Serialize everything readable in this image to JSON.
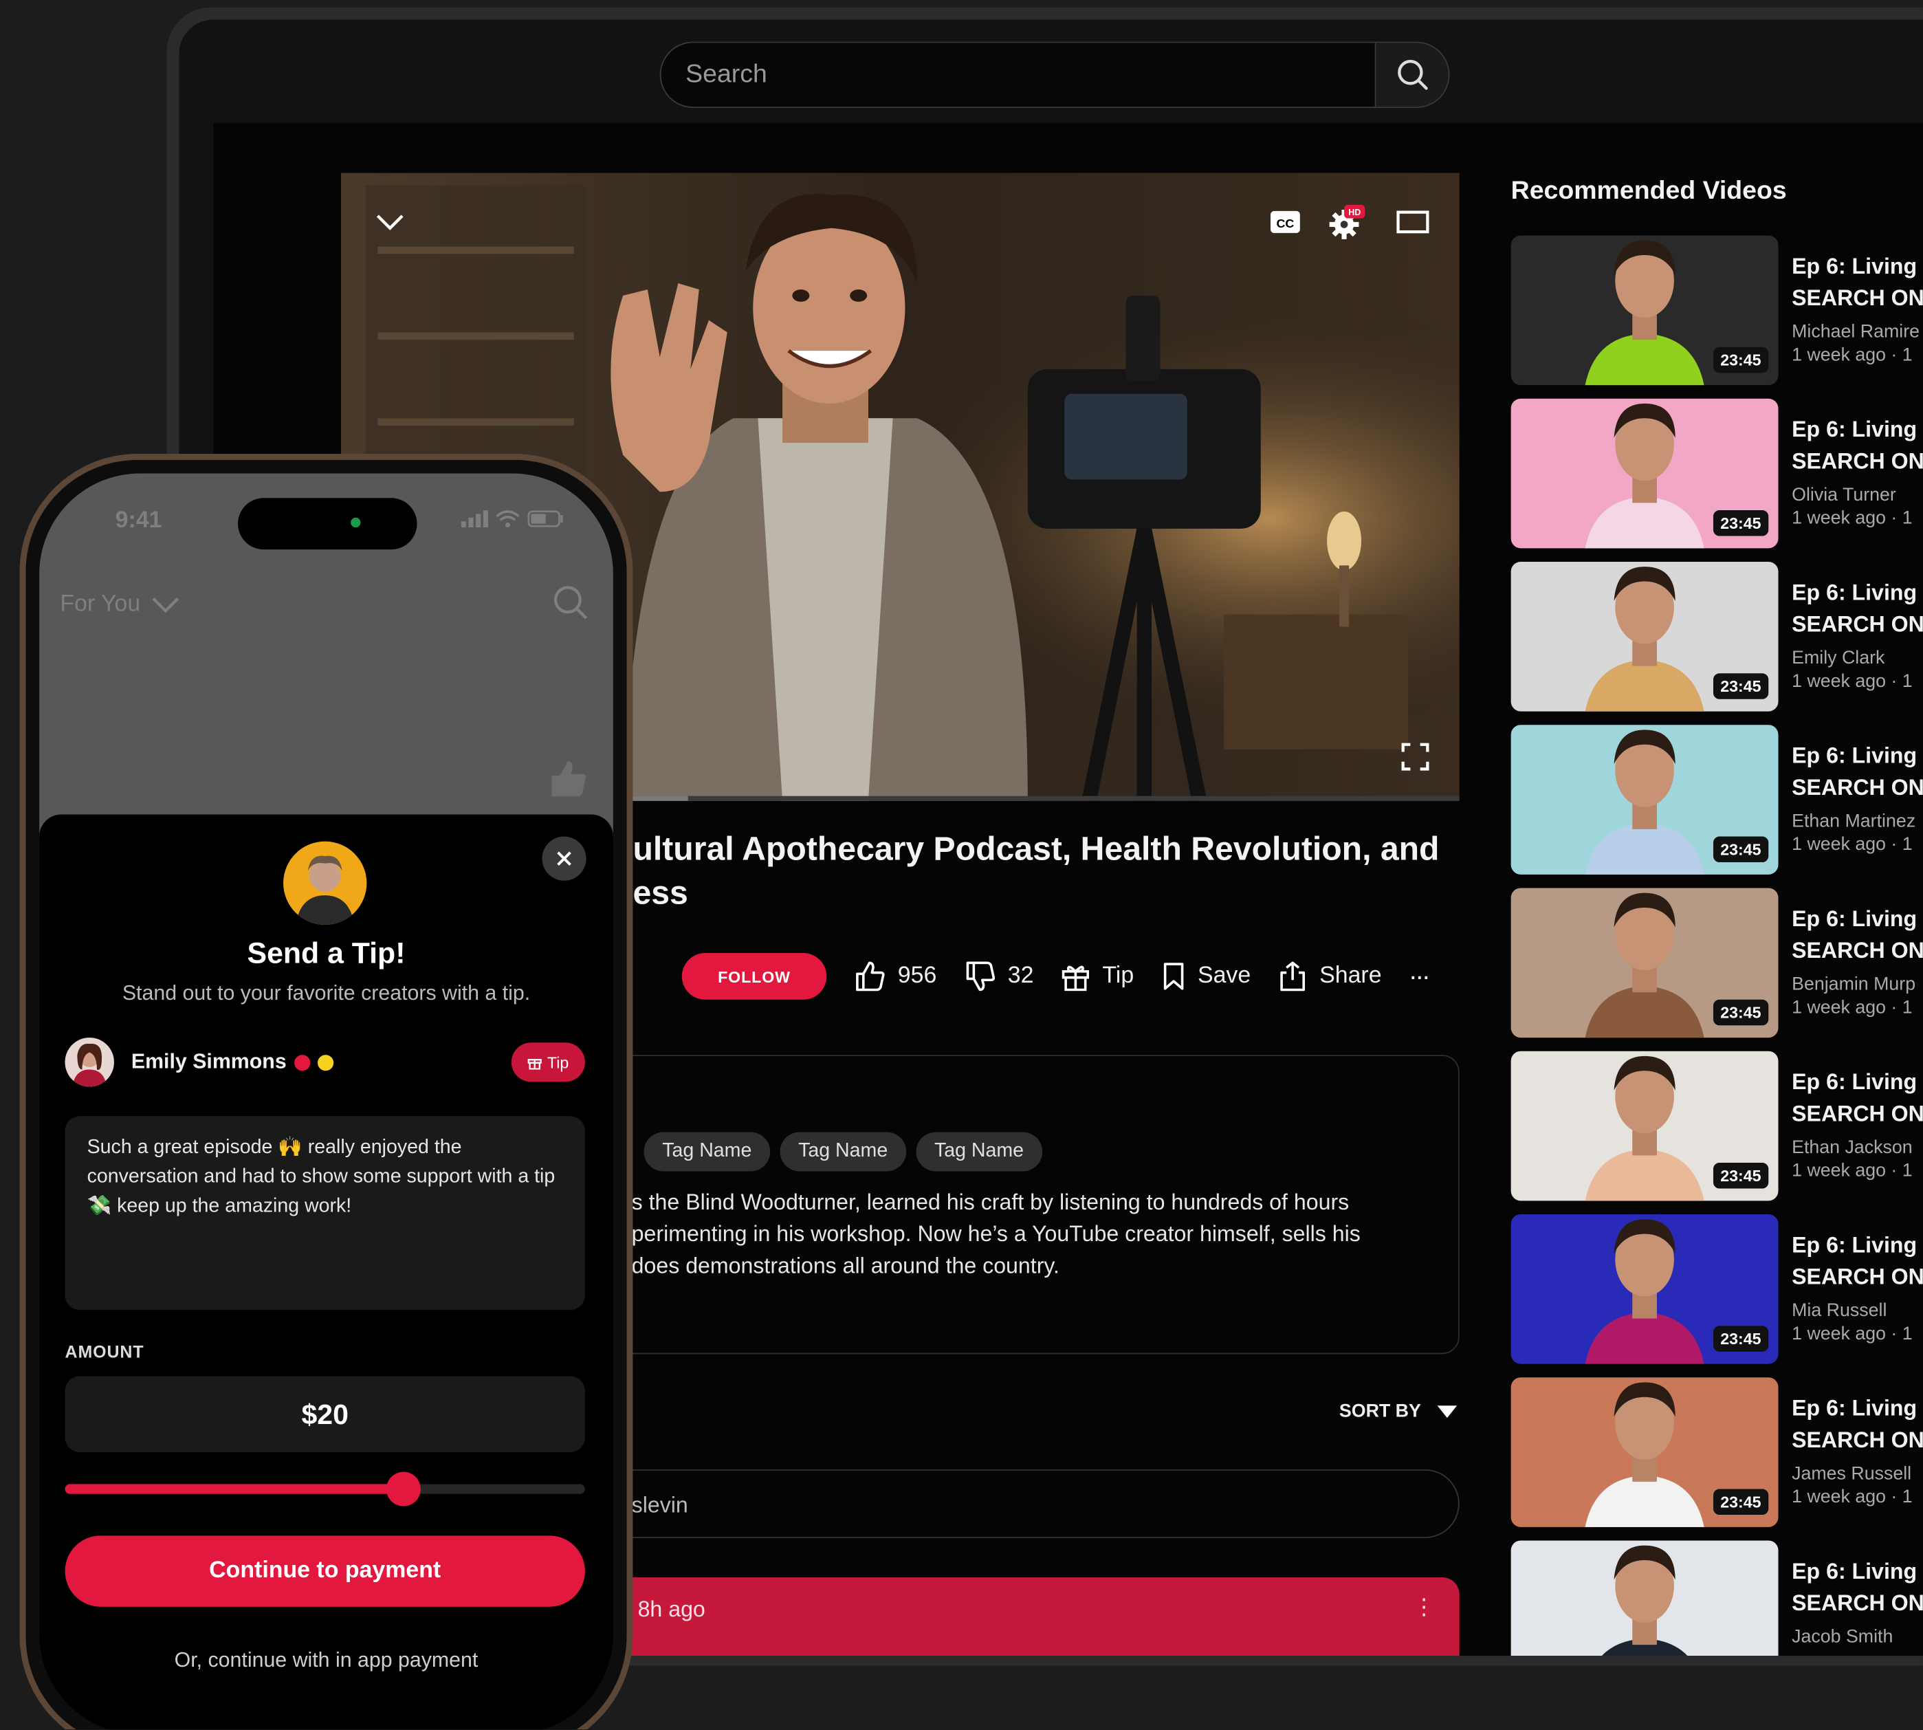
{
  "search": {
    "placeholder": "Search"
  },
  "player": {
    "cc_icon": "closed-captions-icon",
    "hd_badge": "HD",
    "progress_fraction": 0.31
  },
  "video": {
    "title_line1": "ultural Apothecary Podcast, Health Revolution, and",
    "title_line2": "ess",
    "follow_label": "FOLLOW",
    "likes": "956",
    "dislikes": "32",
    "tip_label": "Tip",
    "save_label": "Save",
    "share_label": "Share",
    "more_label": "···"
  },
  "description": {
    "tags": [
      "Tag Name",
      "Tag Name",
      "Tag Name"
    ],
    "lines": [
      "s the Blind Woodturner, learned his craft by listening to hundreds of hours",
      "perimenting in his workshop. Now he’s a YouTube creator himself, sells his",
      "does demonstrations all around the country."
    ]
  },
  "comments": {
    "sort_label": "SORT BY",
    "input_value": "slevin",
    "pinned_time": "8h ago",
    "pinned_menu": "⋮"
  },
  "recommended": {
    "title": "Recommended Videos",
    "items": [
      {
        "title1": "Ep 6: Living t",
        "title2": "SEARCH ON",
        "channel": "Michael Ramire",
        "age": "1 week ago · 1",
        "duration": "23:45",
        "bg": "#2a2a2a",
        "accent": "#8fd11e"
      },
      {
        "title1": "Ep 6: Living t",
        "title2": "SEARCH ON",
        "channel": "Olivia Turner",
        "age": "1 week ago · 1",
        "duration": "23:45",
        "bg": "#f2a7c7",
        "accent": "#f5d6e4"
      },
      {
        "title1": "Ep 6: Living t",
        "title2": "SEARCH ON",
        "channel": "Emily Clark",
        "age": "1 week ago · 1",
        "duration": "23:45",
        "bg": "#d8d8d8",
        "accent": "#d9a864"
      },
      {
        "title1": "Ep 6: Living t",
        "title2": "SEARCH ON",
        "channel": "Ethan Martinez",
        "age": "1 week ago · 1",
        "duration": "23:45",
        "bg": "#9fd6dc",
        "accent": "#b7cfe8"
      },
      {
        "title1": "Ep 6: Living t",
        "title2": "SEARCH ON",
        "channel": "Benjamin Murp",
        "age": "1 week ago · 1",
        "duration": "23:45",
        "bg": "#b79a86",
        "accent": "#8a5a3e"
      },
      {
        "title1": "Ep 6: Living t",
        "title2": "SEARCH ON",
        "channel": "Ethan Jackson",
        "age": "1 week ago · 1",
        "duration": "23:45",
        "bg": "#e6e2de",
        "accent": "#e9b99a"
      },
      {
        "title1": "Ep 6: Living t",
        "title2": "SEARCH ON",
        "channel": "Mia Russell",
        "age": "1 week ago · 1",
        "duration": "23:45",
        "bg": "#2a2ab8",
        "accent": "#b01868"
      },
      {
        "title1": "Ep 6: Living t",
        "title2": "SEARCH ON",
        "channel": "James Russell",
        "age": "1 week ago · 1",
        "duration": "23:45",
        "bg": "#c9785a",
        "accent": "#f2f2f2"
      },
      {
        "title1": "Ep 6: Living t",
        "title2": "SEARCH ON",
        "channel": "Jacob Smith",
        "age": "",
        "duration": "",
        "bg": "#e2e6ea",
        "accent": "#1c2430"
      }
    ]
  },
  "phone": {
    "time": "9:41",
    "feed_label": "For You",
    "sheet": {
      "title": "Send a Tip!",
      "subtitle": "Stand out to your favorite creators with a tip.",
      "creator_name": "Emily Simmons",
      "creator_tip_label": "Tip",
      "message": "Such a great episode 🙌 really enjoyed the conversation and had to show some support with a tip 💸 keep up the amazing work!",
      "amount_label": "AMOUNT",
      "amount_value": "$20",
      "slider_fraction": 0.65,
      "pay_label": "Continue to payment",
      "alt_label": "Or, continue with in app payment"
    }
  },
  "colors": {
    "accent": "#e3183e",
    "background": "#050505"
  }
}
